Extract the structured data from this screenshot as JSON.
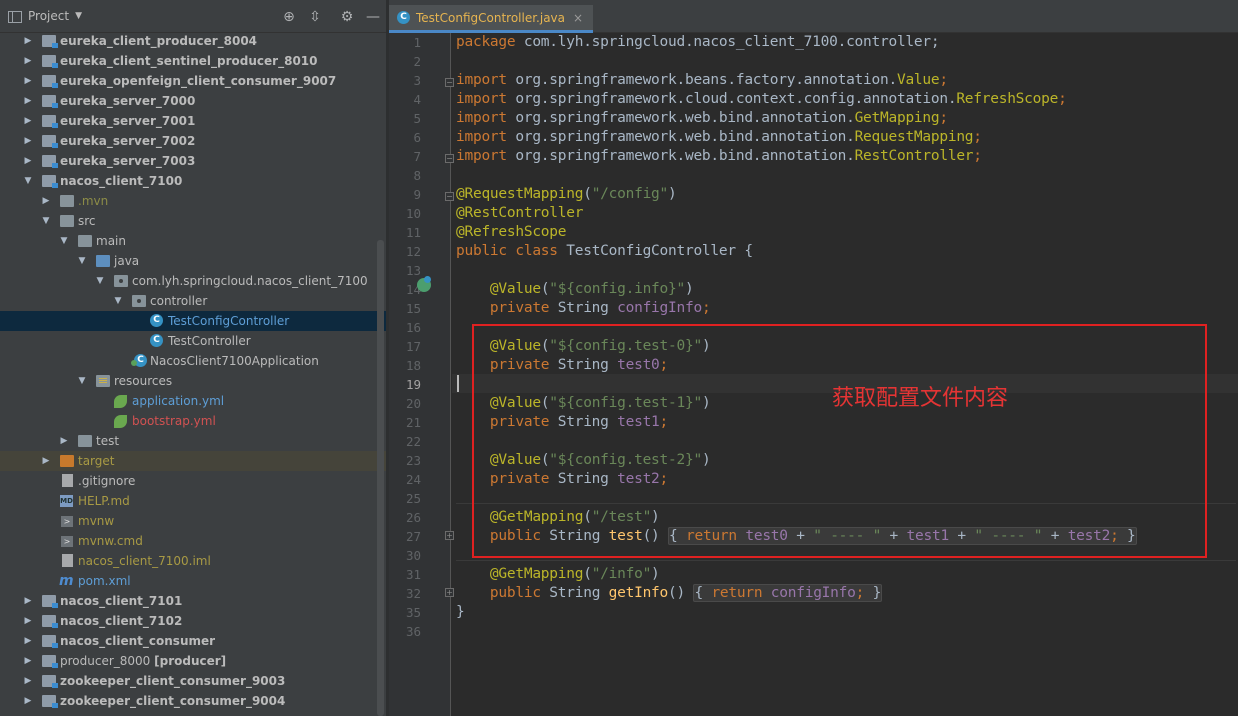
{
  "panel": {
    "title": "Project",
    "icons": [
      "crosshair-icon",
      "collapse-icon",
      "gear-icon",
      "minimize-icon"
    ]
  },
  "tree": [
    {
      "label": "eureka_client_producer_8004",
      "kind": "module"
    },
    {
      "label": "eureka_client_sentinel_producer_8010",
      "kind": "module"
    },
    {
      "label": "eureka_openfeign_client_consumer_9007",
      "kind": "module"
    },
    {
      "label": "eureka_server_7000",
      "kind": "module"
    },
    {
      "label": "eureka_server_7001",
      "kind": "module"
    },
    {
      "label": "eureka_server_7002",
      "kind": "module"
    },
    {
      "label": "eureka_server_7003",
      "kind": "module"
    },
    {
      "label": "nacos_client_7100",
      "kind": "module",
      "expanded": true
    },
    {
      "label": ".mvn",
      "kind": "folder"
    },
    {
      "label": "src",
      "kind": "folder",
      "expanded": true
    },
    {
      "label": "main",
      "kind": "folder",
      "expanded": true
    },
    {
      "label": "java",
      "kind": "source-folder",
      "expanded": true
    },
    {
      "label": "com.lyh.springcloud.nacos_client_7100",
      "kind": "package",
      "expanded": true
    },
    {
      "label": "controller",
      "kind": "package",
      "expanded": true
    },
    {
      "label": "TestConfigController",
      "kind": "class",
      "selected": true
    },
    {
      "label": "TestController",
      "kind": "class"
    },
    {
      "label": "NacosClient7100Application",
      "kind": "app-class"
    },
    {
      "label": "resources",
      "kind": "resources",
      "expanded": true
    },
    {
      "label": "application.yml",
      "kind": "yml"
    },
    {
      "label": "bootstrap.yml",
      "kind": "yml"
    },
    {
      "label": "test",
      "kind": "folder"
    },
    {
      "label": "target",
      "kind": "excluded-folder"
    },
    {
      "label": ".gitignore",
      "kind": "file"
    },
    {
      "label": "HELP.md",
      "kind": "md"
    },
    {
      "label": "mvnw",
      "kind": "script"
    },
    {
      "label": "mvnw.cmd",
      "kind": "script"
    },
    {
      "label": "nacos_client_7100.iml",
      "kind": "file"
    },
    {
      "label": "pom.xml",
      "kind": "maven"
    },
    {
      "label": "nacos_client_7101",
      "kind": "module"
    },
    {
      "label": "nacos_client_7102",
      "kind": "module"
    },
    {
      "label": "nacos_client_consumer",
      "kind": "module"
    },
    {
      "label": "producer_8000",
      "suffix": "[producer]",
      "kind": "module"
    },
    {
      "label": "zookeeper_client_consumer_9003",
      "kind": "module"
    },
    {
      "label": "zookeeper_client_consumer_9004",
      "kind": "module"
    }
  ],
  "editor": {
    "tab": {
      "label": "TestConfigController.java",
      "close": "×"
    },
    "current_line": 19,
    "lines": [
      {
        "n": "1"
      },
      {
        "n": "2"
      },
      {
        "n": "3"
      },
      {
        "n": "4"
      },
      {
        "n": "5"
      },
      {
        "n": "6"
      },
      {
        "n": "7"
      },
      {
        "n": "8"
      },
      {
        "n": "9"
      },
      {
        "n": "10"
      },
      {
        "n": "11"
      },
      {
        "n": "12"
      },
      {
        "n": "13"
      },
      {
        "n": "14"
      },
      {
        "n": "15"
      },
      {
        "n": "16"
      },
      {
        "n": "17"
      },
      {
        "n": "18"
      },
      {
        "n": "19"
      },
      {
        "n": "20"
      },
      {
        "n": "21"
      },
      {
        "n": "22"
      },
      {
        "n": "23"
      },
      {
        "n": "24"
      },
      {
        "n": "25"
      },
      {
        "n": "26"
      },
      {
        "n": "27"
      },
      {
        "n": "30"
      },
      {
        "n": "31"
      },
      {
        "n": "32"
      },
      {
        "n": "35"
      },
      {
        "n": "36"
      }
    ],
    "code": {
      "l1": {
        "kw": "package",
        "rest": " com.lyh.springcloud.nacos_client_7100.controller;"
      },
      "l3": {
        "kw": "import",
        "pre": " org.springframework.beans.factory.annotation.",
        "cls": "Value",
        "end": ";"
      },
      "l4": {
        "kw": "import",
        "pre": " org.springframework.cloud.context.config.annotation.",
        "cls": "RefreshScope",
        "end": ";"
      },
      "l5": {
        "kw": "import",
        "pre": " org.springframework.web.bind.annotation.",
        "cls": "GetMapping",
        "end": ";"
      },
      "l6": {
        "kw": "import",
        "pre": " org.springframework.web.bind.annotation.",
        "cls": "RequestMapping",
        "end": ";"
      },
      "l7": {
        "kw": "import",
        "pre": " org.springframework.web.bind.annotation.",
        "cls": "RestController",
        "end": ";"
      },
      "l9": {
        "ann": "@RequestMapping",
        "open": "(",
        "str": "\"/config\"",
        "close": ")"
      },
      "l10": {
        "ann": "@RestController"
      },
      "l11": {
        "ann": "@RefreshScope"
      },
      "l12": {
        "kw1": "public",
        "kw2": " class",
        "rest": " TestConfigController {"
      },
      "l14": {
        "ann": "@Value",
        "open": "(",
        "str": "\"${config.info}\"",
        "close": ")"
      },
      "l15": {
        "kw": "private",
        "type": " String ",
        "field": "configInfo",
        "end": ";"
      },
      "l17": {
        "ann": "@Value",
        "open": "(",
        "str": "\"${config.test-0}\"",
        "close": ")"
      },
      "l18": {
        "kw": "private",
        "type": " String ",
        "field": "test0",
        "end": ";"
      },
      "l20": {
        "ann": "@Value",
        "open": "(",
        "str": "\"${config.test-1}\"",
        "close": ")"
      },
      "l21": {
        "kw": "private",
        "type": " String ",
        "field": "test1",
        "end": ";"
      },
      "l23": {
        "ann": "@Value",
        "open": "(",
        "str": "\"${config.test-2}\"",
        "close": ")"
      },
      "l24": {
        "kw": "private",
        "type": " String ",
        "field": "test2",
        "end": ";"
      },
      "l26": {
        "ann": "@GetMapping",
        "open": "(",
        "str": "\"/test\"",
        "close": ")"
      },
      "l27": {
        "kw": "public",
        "type": " String ",
        "method": "test",
        "paren": "() ",
        "fold_open": "{ ",
        "ret": "return",
        "f0": " test0",
        "plus1": " + ",
        "s1": "\" ---- \"",
        "plus2": " + ",
        "f1": "test1",
        "plus3": " + ",
        "s2": "\" ---- \"",
        "plus4": " + ",
        "f2": "test2",
        "semi": ";",
        "fold_close": " }"
      },
      "l31": {
        "ann": "@GetMapping",
        "open": "(",
        "str": "\"/info\"",
        "close": ")"
      },
      "l32": {
        "kw": "public",
        "type": " String ",
        "method": "getInfo",
        "paren": "() ",
        "fold_open": "{ ",
        "ret": "return",
        "f0": " configInfo",
        "semi": ";",
        "fold_close": " }"
      },
      "l35": {
        "text": "}"
      }
    },
    "annotation": {
      "text": "获取配置文件内容",
      "color": "#e53434"
    }
  }
}
